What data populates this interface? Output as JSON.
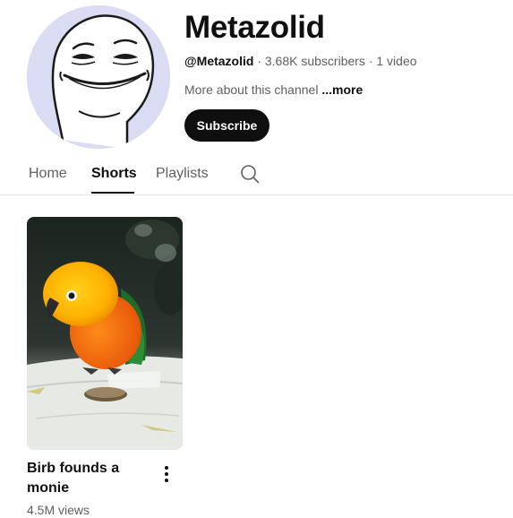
{
  "channel": {
    "name": "Metazolid",
    "handle": "@Metazolid",
    "stats": " · 3.68K subscribers · 1 video",
    "about": "More about this channel ",
    "more_label": "...more",
    "subscribe_label": "Subscribe",
    "avatar_icon": "meme-face-avatar",
    "avatar_bg": "#d9dcf2"
  },
  "tabs": [
    {
      "label": "Home",
      "active": false
    },
    {
      "label": "Shorts",
      "active": true
    },
    {
      "label": "Playlists",
      "active": false
    }
  ],
  "search_icon": "search-icon",
  "shorts": [
    {
      "title": "Birb founds a monie",
      "views": "4.5M views",
      "thumbnail": "parrot-with-coin",
      "menu_icon": "more-vert-icon"
    }
  ],
  "colors": {
    "text_primary": "#0f0f0f",
    "text_secondary": "#606060",
    "subscribe_bg": "#0f0f0f",
    "divider": "#e5e5e5"
  }
}
